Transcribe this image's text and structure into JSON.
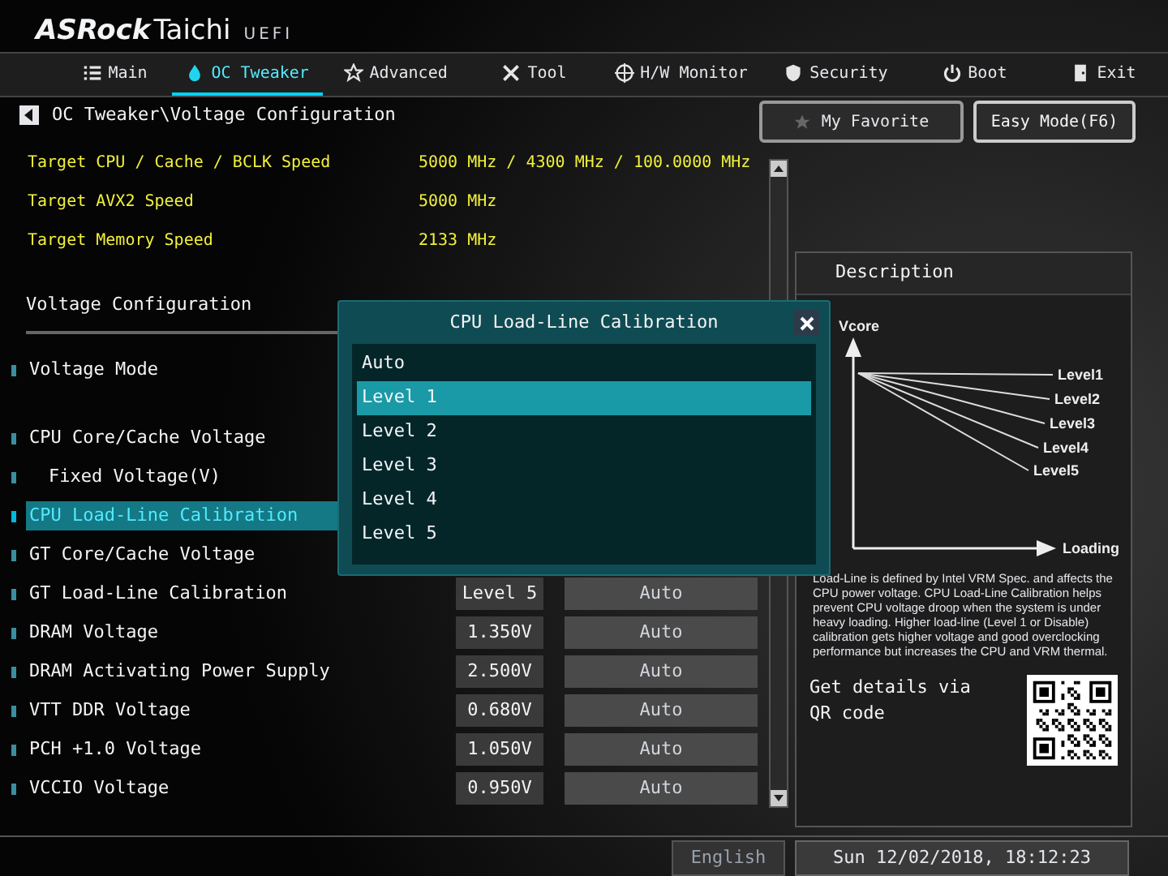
{
  "header": {
    "brand": "ASRock",
    "model": "Taichi",
    "firmware": "UEFI"
  },
  "tabs": [
    {
      "label": "Main",
      "selected": false
    },
    {
      "label": "OC Tweaker",
      "selected": true
    },
    {
      "label": "Advanced",
      "selected": false
    },
    {
      "label": "Tool",
      "selected": false
    },
    {
      "label": "H/W Monitor",
      "selected": false
    },
    {
      "label": "Security",
      "selected": false
    },
    {
      "label": "Boot",
      "selected": false
    },
    {
      "label": "Exit",
      "selected": false
    }
  ],
  "breadcrumb": "OC Tweaker\\Voltage Configuration",
  "favorite_button": "My Favorite",
  "easy_mode_button": "Easy Mode(F6)",
  "targets": [
    {
      "label": "Target CPU / Cache / BCLK Speed",
      "value": "5000 MHz / 4300 MHz / 100.0000 MHz"
    },
    {
      "label": "Target AVX2 Speed",
      "value": "5000 MHz"
    },
    {
      "label": "Target Memory Speed",
      "value": "2133 MHz"
    }
  ],
  "section_title": "Voltage Configuration",
  "settings": [
    {
      "label": "Voltage Mode",
      "selected": false
    },
    {
      "label": "CPU Core/Cache Voltage",
      "selected": false,
      "children": [
        {
          "label": "Fixed Voltage(V)",
          "selected": false
        }
      ]
    },
    {
      "label": "CPU Load-Line Calibration",
      "selected": true
    },
    {
      "label": "GT Core/Cache Voltage",
      "selected": false
    },
    {
      "label": "GT Load-Line Calibration",
      "selected": false,
      "value": "Level 5",
      "option": "Auto"
    },
    {
      "label": "DRAM Voltage",
      "selected": false,
      "value": "1.350V",
      "option": "Auto"
    },
    {
      "label": "DRAM Activating Power Supply",
      "selected": false,
      "value": "2.500V",
      "option": "Auto"
    },
    {
      "label": "VTT DDR Voltage",
      "selected": false,
      "value": "0.680V",
      "option": "Auto"
    },
    {
      "label": "PCH +1.0 Voltage",
      "selected": false,
      "value": "1.050V",
      "option": "Auto"
    },
    {
      "label": "VCCIO Voltage",
      "selected": false,
      "value": "0.950V",
      "option": "Auto"
    }
  ],
  "popup": {
    "title": "CPU Load-Line Calibration",
    "options": [
      {
        "label": "Auto",
        "selected": false
      },
      {
        "label": "Level 1",
        "selected": true
      },
      {
        "label": "Level 2",
        "selected": false
      },
      {
        "label": "Level 3",
        "selected": false
      },
      {
        "label": "Level 4",
        "selected": false
      },
      {
        "label": "Level 5",
        "selected": false
      }
    ]
  },
  "description": {
    "title": "Description",
    "diagram": {
      "y_axis": "Vcore",
      "x_axis": "Loading",
      "lines": [
        "Level1",
        "Level2",
        "Level3",
        "Level4",
        "Level5"
      ]
    },
    "text": "Load-Line is defined by Intel VRM Spec. and affects the CPU power voltage. CPU Load-Line Calibration helps prevent CPU voltage droop when the system is under heavy loading. Higher load-line (Level 1 or Disable) calibration gets higher voltage and good overclocking performance but increases the CPU and VRM thermal.",
    "qr_text": "Get details via QR code"
  },
  "status_bar": {
    "language": "English",
    "datetime": "Sun 12/02/2018, 18:12:23"
  }
}
